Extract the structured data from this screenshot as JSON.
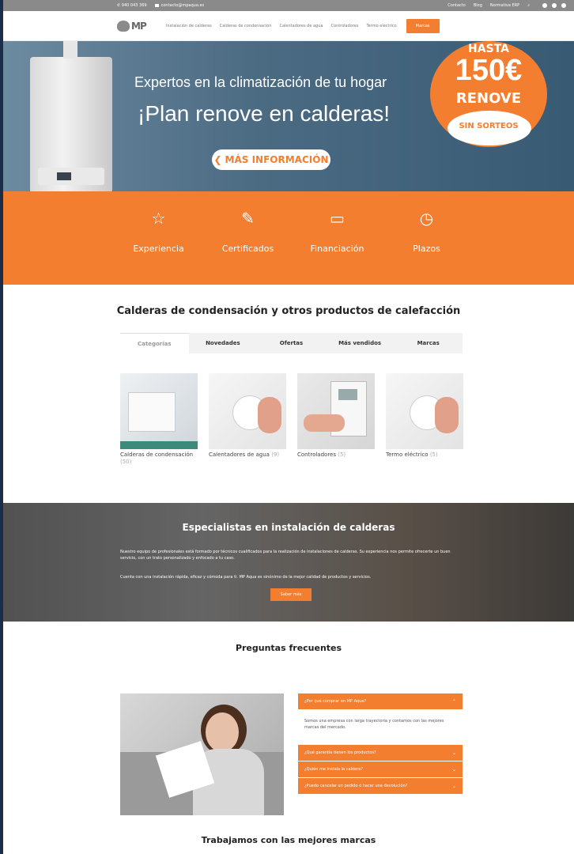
{
  "topbar": {
    "phone": "940 043 369",
    "email": "contacto@mpaqua.es",
    "links": [
      "Contacto",
      "Blog",
      "Normativa ERP"
    ]
  },
  "nav": {
    "logo": "MP",
    "menu": [
      "Instalación de calderas",
      "Calderas de condensación",
      "Calentadores de agua",
      "Controladores",
      "Termo eléctrico"
    ],
    "brands_button": "Marcas"
  },
  "hero": {
    "subtitle": "Expertos en la climatización de tu hogar",
    "title": "¡Plan renove en calderas!",
    "cta": "MÁS INFORMACIÓN",
    "badge": {
      "top": "HASTA",
      "amount": "150€",
      "label": "RENOVE",
      "note": "SIN SORTEOS"
    }
  },
  "features": [
    {
      "icon": "star-icon",
      "glyph": "☆",
      "label": "Experiencia"
    },
    {
      "icon": "certificate-icon",
      "glyph": "✎",
      "label": "Certificados"
    },
    {
      "icon": "credit-card-icon",
      "glyph": "▭",
      "label": "Financiación"
    },
    {
      "icon": "history-icon",
      "glyph": "◷",
      "label": "Plazos"
    }
  ],
  "products": {
    "title": "Calderas de condensación y otros productos de calefacción",
    "tabs": [
      "Categorías",
      "Novedades",
      "Ofertas",
      "Más vendidos",
      "Marcas"
    ],
    "cards": [
      {
        "name": "Calderas de condensación",
        "count": "(50)"
      },
      {
        "name": "Calentadores de agua",
        "count": "(9)"
      },
      {
        "name": "Controladores",
        "count": "(5)"
      },
      {
        "name": "Termo eléctrico",
        "count": "(5)"
      }
    ]
  },
  "specialists": {
    "title": "Especialistas en instalación de calderas",
    "p1": "Nuestro equipo de profesionales está formado por técnicos cualificados para la realización de instalaciones de calderas. Su experiencia nos permite ofrecerte un buen servicio, con un trato personalizado y enfocado a tu caso.",
    "p2": "Cuenta con una instalación rápida, eficaz y cómoda para ti. MP Aqua es sinónimo de la mejor calidad de productos y servicios.",
    "button": "Saber más"
  },
  "faq": {
    "title": "Preguntas frecuentes",
    "items": [
      {
        "q": "¿Por qué comprar en MP Aqua?",
        "a": "Somos una empresa con larga trayectoria y contamos con las mejores marcas del mercado.",
        "open": true
      },
      {
        "q": "¿Qué garantía tienen los productos?"
      },
      {
        "q": "¿Quién me instala la caldera?"
      },
      {
        "q": "¿Puedo cancelar un pedido o hacer una devolución?"
      }
    ]
  },
  "brands_section": {
    "title": "Trabajamos con las mejores marcas"
  }
}
